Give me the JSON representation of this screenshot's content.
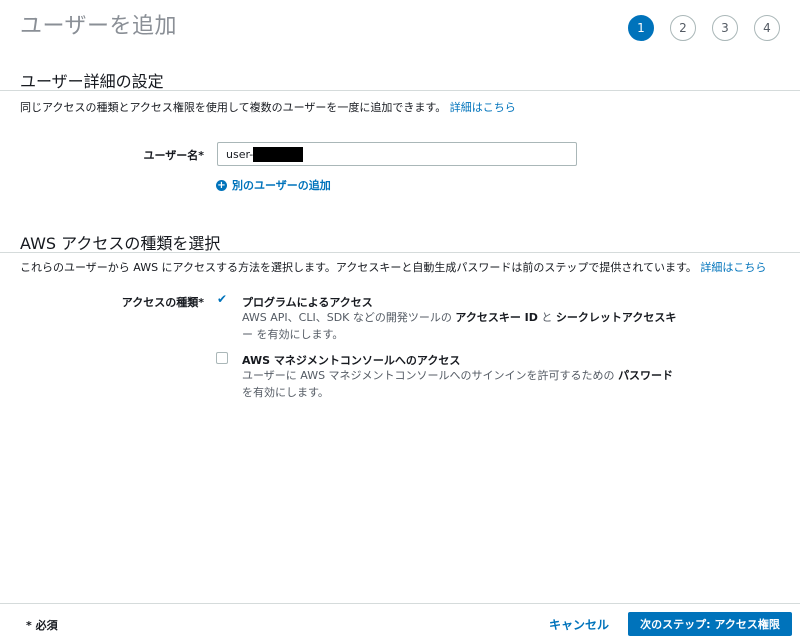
{
  "page": {
    "title": "ユーザーを追加"
  },
  "steps": [
    "1",
    "2",
    "3",
    "4"
  ],
  "details": {
    "heading": "ユーザー詳細の設定",
    "description": "同じアクセスの種類とアクセス権限を使用して複数のユーザーを一度に追加できます。",
    "learn_more": "詳細はこちら",
    "username_label": "ユーザー名*",
    "username_value": "user-",
    "add_another": "別のユーザーの追加"
  },
  "access": {
    "heading": "AWS アクセスの種類を選択",
    "description": "これらのユーザーから AWS にアクセスする方法を選択します。アクセスキーと自動生成パスワードは前のステップで提供されています。",
    "learn_more": "詳細はこちら",
    "type_label": "アクセスの種類*",
    "options": [
      {
        "title": "プログラムによるアクセス",
        "checked": true,
        "desc_1": "AWS API、CLI、SDK などの開発ツールの ",
        "desc_bold_1": "アクセスキー ID",
        "desc_2": " と ",
        "desc_bold_2": "シークレットアクセスキ",
        "desc_3": "ー を有効にします。"
      },
      {
        "title": "AWS マネジメントコンソールへのアクセス",
        "checked": false,
        "desc_1": "ユーザーに AWS マネジメントコンソールへのサインインを許可するための ",
        "desc_bold_1": "パスワード",
        "desc_2": "を有効にします。"
      }
    ]
  },
  "footer": {
    "required": "* 必須",
    "cancel": "キャンセル",
    "next": "次のステップ: アクセス権限"
  },
  "colors": {
    "accent": "#0073bb",
    "border": "#d5dbdb"
  }
}
